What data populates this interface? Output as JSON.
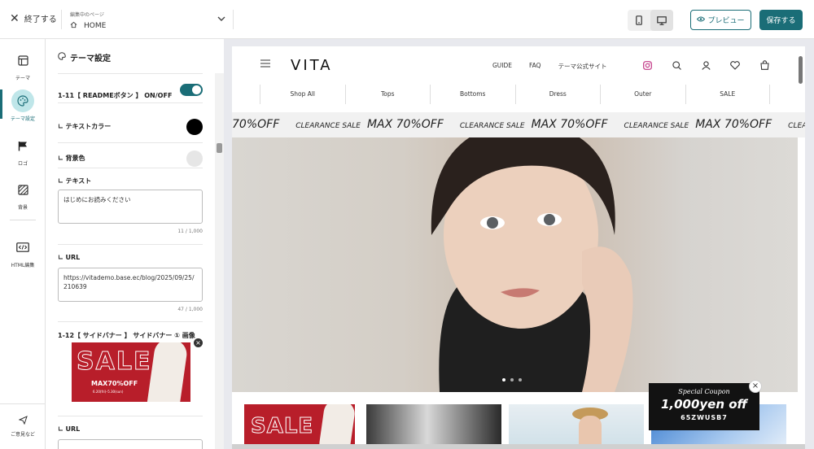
{
  "topbar": {
    "exit_label": "終了する",
    "editing_caption": "編集中のページ",
    "current_page": "HOME",
    "preview_label": "プレビュー",
    "save_label": "保存する"
  },
  "leftnav": {
    "items": [
      {
        "label": "テーマ",
        "icon": "layout-icon"
      },
      {
        "label": "テーマ設定",
        "icon": "palette-icon",
        "active": true
      },
      {
        "label": "ロゴ",
        "icon": "flag-icon"
      },
      {
        "label": "背景",
        "icon": "texture-icon"
      },
      {
        "label": "HTML編集",
        "icon": "code-icon"
      }
    ],
    "feedback_label": "ご意見など"
  },
  "panel": {
    "title": "テーマ設定",
    "readme_toggle_label": "1-11【 READMEボタン 】 ON/OFF",
    "text_color_label": "∟ テキストカラー",
    "text_color_value": "#000000",
    "bg_color_label": "∟ 背景色",
    "bg_color_value": "#e6e6e6",
    "text_label": "∟ テキスト",
    "text_value": "はじめにお読みください",
    "text_count": "11 / 1,000",
    "url_label": "∟ URL",
    "url_value": "https://vitademo.base.ec/blog/2025/09/25/210639",
    "url_count": "47 / 1,000",
    "side_banner_label": "1-12【 サイドバナー 】 サイドバナー ① 画像",
    "banner_big": "SALE",
    "banner_sub": "MAX70%OFF",
    "banner_date": "6.20(fri)–5.30(sun)",
    "url2_label": "∟ URL"
  },
  "site": {
    "logo": "VITA",
    "nav": [
      "GUIDE",
      "FAQ",
      "テーマ公式サイト"
    ],
    "categories": [
      "Shop All",
      "Tops",
      "Bottoms",
      "Dress",
      "Outer",
      "SALE"
    ],
    "ticker_a": "CLEARANCE SALE",
    "ticker_b": "MAX 70%OFF",
    "ticker_lead": "70%OFF",
    "ticker_tail": "CLEA",
    "thumb_sale": "SALE",
    "coupon": {
      "line1": "Special Coupon",
      "line2": "1,000yen off",
      "code": "65ZWUSB7"
    }
  },
  "colors": {
    "accent": "#1a6d77",
    "accent_light": "#bfe6e9",
    "instagram": "#c13584"
  }
}
